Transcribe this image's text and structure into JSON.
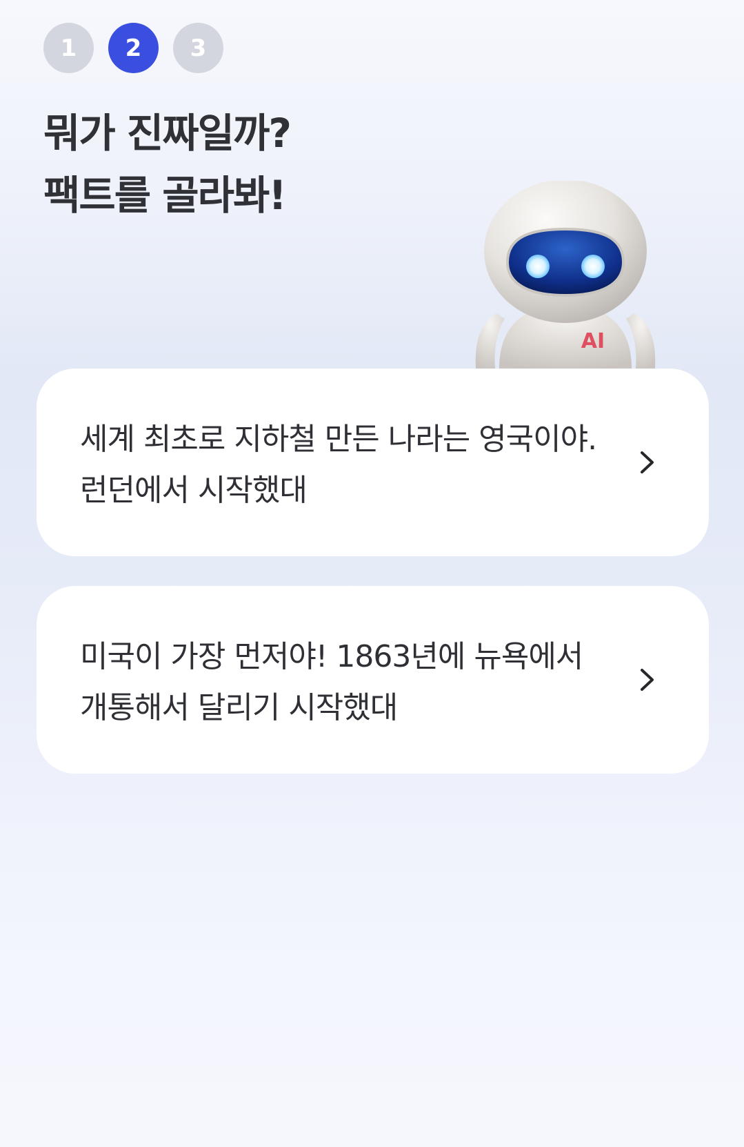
{
  "steps": [
    {
      "label": "1",
      "state": "inactive"
    },
    {
      "label": "2",
      "state": "active"
    },
    {
      "label": "3",
      "state": "inactive"
    }
  ],
  "title": {
    "line1": "뭐가 진짜일까?",
    "line2": "팩트를 골라봐!"
  },
  "mascot": {
    "chest_label": "AI",
    "icon": "robot-mascot-icon"
  },
  "options": [
    {
      "text": "세계 최초로 지하철 만든 나라는 영국이야. 런던에서 시작했대",
      "icon": "chevron-right-icon"
    },
    {
      "text": "미국이 가장 먼저야! 1863년에 뉴욕에서 개통해서 달리기 시작했대",
      "icon": "chevron-right-icon"
    }
  ],
  "colors": {
    "active_step": "#3a4fe0",
    "inactive_step": "#d3d6de",
    "title_text": "#2f3137",
    "card_bg": "#ffffff"
  }
}
